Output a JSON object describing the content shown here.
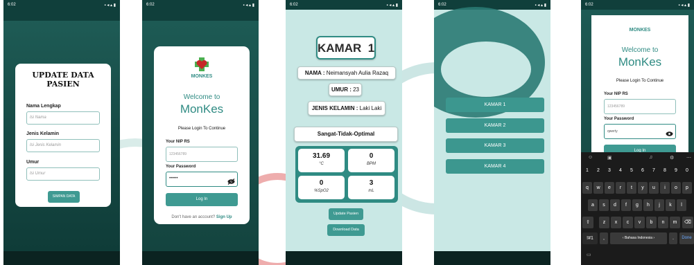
{
  "status_time": "6:02",
  "screen1": {
    "title_line1": "UPDATE DATA",
    "title_line2": "PASIEN",
    "fields": [
      {
        "label": "Nama Lengkap",
        "placeholder": "Isi Nama"
      },
      {
        "label": "Jenis Kelamin",
        "placeholder": "Isi Jenis Kelamin"
      },
      {
        "label": "Umur",
        "placeholder": "Isi Umur"
      }
    ],
    "submit_label": "SIMPAN DATA"
  },
  "screen2": {
    "brand": "MONKES",
    "welcome": "Welcome to",
    "app_name": "MonKes",
    "subtitle": "Please Login To Continue",
    "nip_label": "Your NIP RS",
    "nip_value": "123456789",
    "password_label": "Your Password",
    "password_value": "••••••",
    "login_label": "Log In",
    "signup_prompt": "Don't have an account?",
    "signup_link": "Sign Up"
  },
  "screen3": {
    "room_title": "KAMAR  1",
    "nama_label": "NAMA :",
    "nama_value": "Neimansyah Aulia Razaq",
    "umur_label": "UMUR :",
    "umur_value": "23",
    "jk_label": "JENIS KELAMIN :",
    "jk_value": "Laki Laki",
    "status": "Sangat-Tidak-Optimal",
    "metrics": [
      {
        "value": "31.69",
        "unit": "°C"
      },
      {
        "value": "0",
        "unit": "BPM"
      },
      {
        "value": "0",
        "unit": "%SpO2"
      },
      {
        "value": "3",
        "unit": "mL"
      }
    ],
    "update_label": "Update Pasien",
    "download_label": "Download Data"
  },
  "screen4": {
    "rooms": [
      "KAMAR 1",
      "KAMAR 2",
      "KAMAR 3",
      "KAMAR 4"
    ]
  },
  "screen5": {
    "brand": "MONKES",
    "welcome": "Welcome to",
    "app_name": "MonKes",
    "subtitle": "Please Login To Continue",
    "nip_label": "Your NIP RS",
    "nip_value": "123456789",
    "password_label": "Your Password",
    "password_value": "qwerty",
    "login_label": "Log In",
    "keyboard": {
      "numbers": [
        "1",
        "2",
        "3",
        "4",
        "5",
        "6",
        "7",
        "8",
        "9",
        "0"
      ],
      "row1": [
        "q",
        "w",
        "e",
        "r",
        "t",
        "y",
        "u",
        "i",
        "o",
        "p"
      ],
      "row2": [
        "a",
        "s",
        "d",
        "f",
        "g",
        "h",
        "j",
        "k",
        "l"
      ],
      "row3": [
        "z",
        "x",
        "c",
        "v",
        "b",
        "n",
        "m"
      ],
      "symbols_key": "!#1",
      "comma_key": ",",
      "space_label": "Bahasa Indonesia",
      "done_key": "Done"
    }
  },
  "colors": {
    "teal": "#3c978f",
    "dark_teal": "#103f3b",
    "light_bg": "#c9e8e5"
  }
}
